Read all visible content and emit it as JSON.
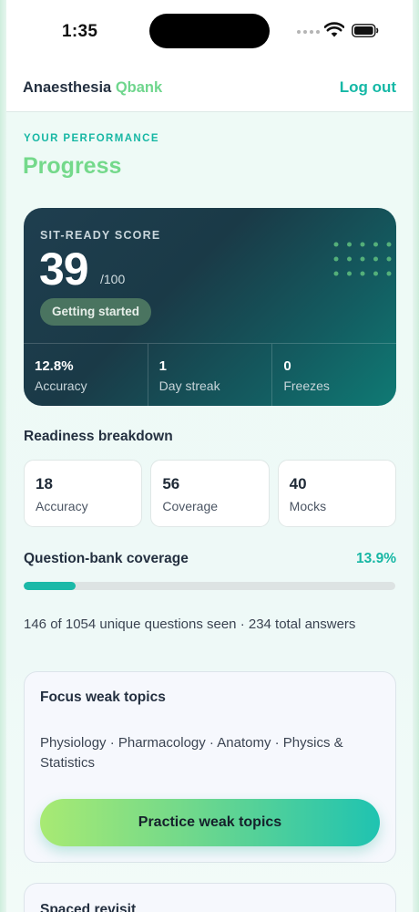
{
  "status": {
    "time": "1:35"
  },
  "header": {
    "brand_main": "Anaesthesia",
    "brand_accent": "Qbank",
    "logout_label": "Log out"
  },
  "page": {
    "eyebrow": "YOUR PERFORMANCE",
    "title": "Progress"
  },
  "score_card": {
    "label": "SIT-READY SCORE",
    "score": "39",
    "max": "/100",
    "badge": "Getting started",
    "stats": [
      {
        "value": "12.8%",
        "label": "Accuracy"
      },
      {
        "value": "1",
        "label": "Day streak"
      },
      {
        "value": "0",
        "label": "Freezes"
      }
    ]
  },
  "breakdown": {
    "heading": "Readiness breakdown",
    "items": [
      {
        "value": "18",
        "label": "Accuracy"
      },
      {
        "value": "56",
        "label": "Coverage"
      },
      {
        "value": "40",
        "label": "Mocks"
      }
    ]
  },
  "coverage": {
    "heading": "Question-bank coverage",
    "percent_label": "13.9%",
    "fraction": 0.139,
    "summary": "146 of 1054 unique questions seen · 234 total answers"
  },
  "weak_topics": {
    "heading": "Focus weak topics",
    "topics": "Physiology · Pharmacology · Anatomy · Physics & Statistics",
    "button_label": "Practice weak topics"
  },
  "revisit": {
    "heading": "Spaced revisit"
  },
  "colors": {
    "accent_teal": "#15b8a6",
    "accent_green": "#74d98b"
  }
}
